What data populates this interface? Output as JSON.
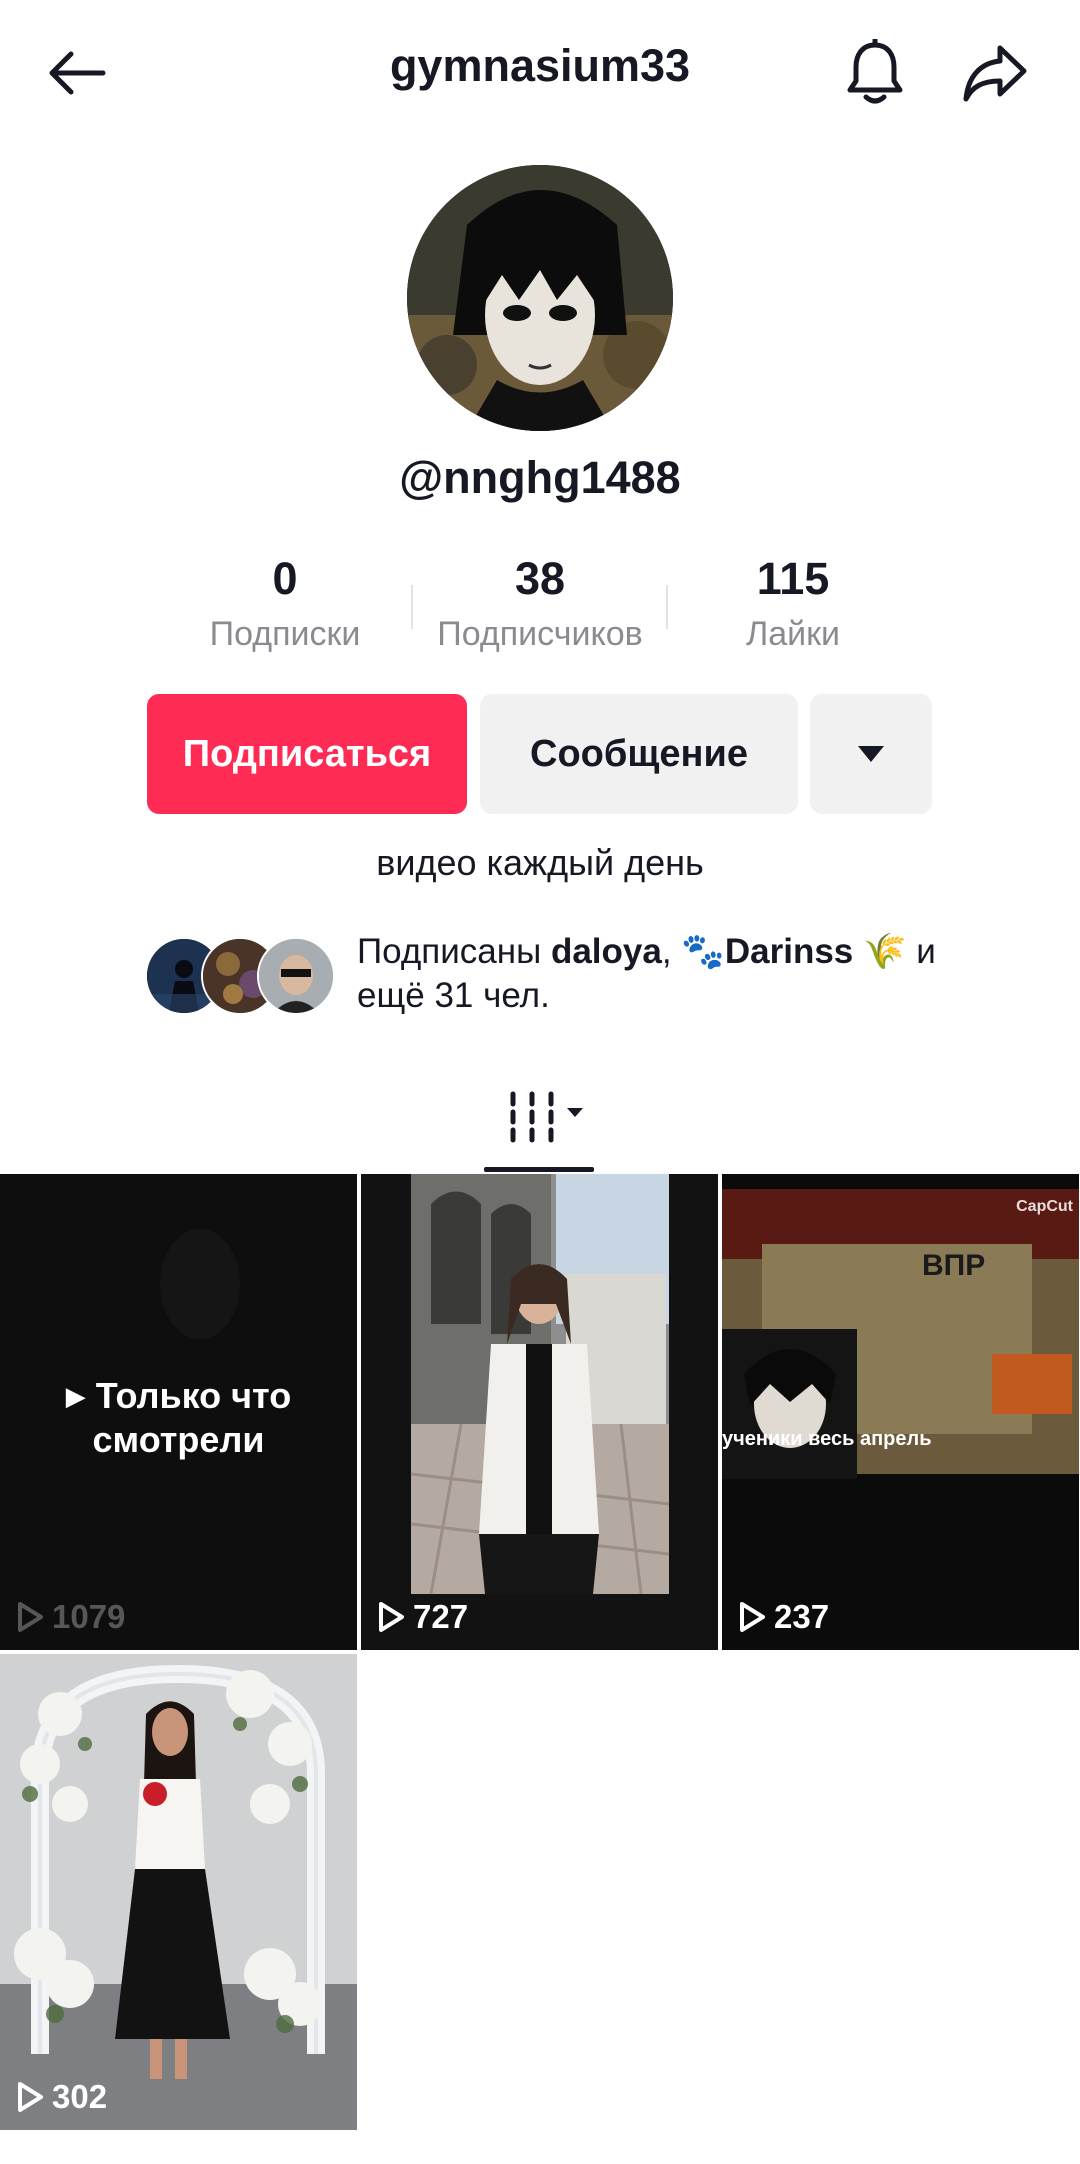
{
  "header": {
    "title": "gymnasium33",
    "back_icon": "arrow-left-icon",
    "bell_icon": "bell-icon",
    "share_icon": "share-arrow-icon"
  },
  "profile": {
    "handle": "@nnghg1488",
    "bio": "видео каждый день"
  },
  "stats": [
    {
      "value": "0",
      "label": "Подписки"
    },
    {
      "value": "38",
      "label": "Подписчиков"
    },
    {
      "value": "115",
      "label": "Лайки"
    }
  ],
  "actions": {
    "follow_label": "Подписаться",
    "message_label": "Сообщение",
    "more_icon": "caret-down-icon"
  },
  "followed_by": {
    "prefix": "Подписаны ",
    "user1": "daloya",
    "sep": ", ",
    "user2": "🐾Darinss 🌾",
    "suffix": " и ещё 31 чел."
  },
  "tabs": {
    "active_icon": "grid-columns-icon"
  },
  "videos": [
    {
      "views": "1079",
      "overlay_line1": "Только что",
      "overlay_line2": "смотрели"
    },
    {
      "views": "727"
    },
    {
      "views": "237",
      "caption_top": "ВПР",
      "caption_mid": "ученики весь апрель",
      "watermark": "CapCut"
    },
    {
      "views": "302"
    }
  ],
  "colors": {
    "accent": "#fe2c55",
    "secondary_button": "#f1f1f2",
    "text": "#161823",
    "muted": "#8a8b91"
  }
}
